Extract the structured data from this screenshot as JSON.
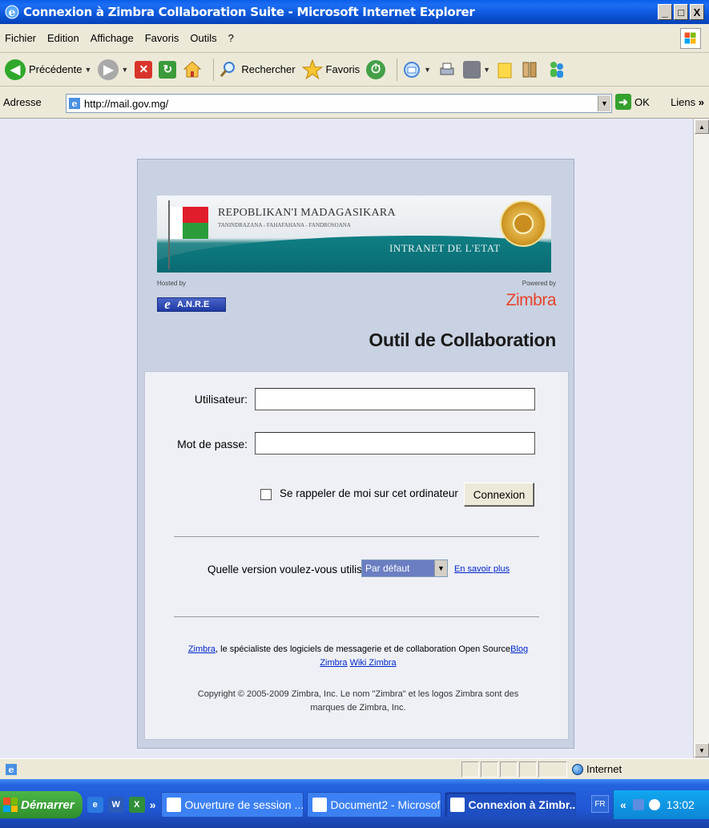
{
  "window": {
    "title": "Connexion à Zimbra Collaboration Suite - Microsoft Internet Explorer",
    "controls": [
      "_",
      "□",
      "X"
    ]
  },
  "menu": [
    "Fichier",
    "Edition",
    "Affichage",
    "Favoris",
    "Outils",
    "?"
  ],
  "toolbar": {
    "back_label": "Précédente",
    "search_label": "Rechercher",
    "favorites_label": "Favoris"
  },
  "address": {
    "label": "Adresse",
    "url": "http://mail.gov.mg/",
    "go_label": "OK",
    "links_label": "Liens",
    "links_chevron": "»"
  },
  "banner": {
    "republic": "REPOBLIKAN'I MADAGASIKARA",
    "motto": "TANINDRAZANA - FAHAFAHANA - FANDROSOANA",
    "intranet": "INTRANET DE L'ETAT"
  },
  "branding": {
    "hosted_by": "Hosted by",
    "anre": "A.N.R.E",
    "powered_by": "Powered by",
    "zimbra_logo": "Zimbra",
    "heading": "Outil de Collaboration"
  },
  "login": {
    "user_label": "Utilisateur:",
    "user_value": "",
    "password_label": "Mot de passe:",
    "password_value": "",
    "remember_label": "Se rappeler de moi sur cet ordinateur",
    "remember_checked": false,
    "submit_label": "Connexion",
    "version_label": "Quelle version voulez-vous utiliser ?",
    "version_selected": "Par défaut",
    "learn_more": "En savoir plus"
  },
  "footer": {
    "zimbra_link": "Zimbra",
    "tagline": ", le spécialiste des logiciels de messagerie et de collaboration Open Source",
    "blog_link": "Blog Zimbra",
    "wiki_link": "Wiki Zimbra",
    "copyright": "Copyright © 2005-2009 Zimbra, Inc. Le nom \"Zimbra\" et les logos Zimbra sont des marques de Zimbra, Inc."
  },
  "status": {
    "zone": "Internet"
  },
  "taskbar": {
    "start": "Démarrer",
    "chevron": "»",
    "tasks": [
      "Ouverture de session ...",
      "Document2 - Microsof...",
      "Connexion à Zimbr..."
    ],
    "lang": "FR",
    "tray_chevron": "«",
    "clock": "13:02"
  },
  "colors": {
    "title_bar": "#0b56d9",
    "page_bg": "#e6e8f6",
    "login_panel": "#c9d2e2",
    "link": "#0026c8",
    "zimbra_red": "#e8432a"
  }
}
